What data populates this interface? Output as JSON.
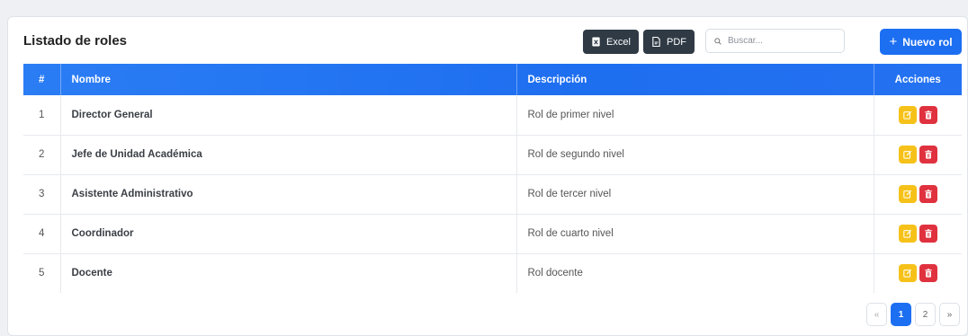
{
  "header": {
    "title": "Listado de roles",
    "excel_label": "Excel",
    "pdf_label": "PDF",
    "search_placeholder": "Buscar...",
    "new_label": "Nuevo rol"
  },
  "table": {
    "columns": [
      "#",
      "Nombre",
      "Descripción",
      "Acciones"
    ],
    "rows": [
      {
        "num": "1",
        "name": "Director General",
        "desc": "Rol de primer nivel"
      },
      {
        "num": "2",
        "name": "Jefe de Unidad Académica",
        "desc": "Rol de segundo nivel"
      },
      {
        "num": "3",
        "name": "Asistente Administrativo",
        "desc": "Rol de tercer nivel"
      },
      {
        "num": "4",
        "name": "Coordinador",
        "desc": "Rol de cuarto nivel"
      },
      {
        "num": "5",
        "name": "Docente",
        "desc": "Rol docente"
      }
    ]
  },
  "pagination": {
    "prev": "«",
    "pages": [
      "1",
      "2"
    ],
    "active_page": "1",
    "next": "»"
  },
  "icons": {
    "excel": "file-excel-icon",
    "pdf": "file-pdf-icon",
    "search": "search-icon",
    "edit": "edit-icon",
    "delete": "trash-icon"
  },
  "colors": {
    "primary": "#1d6ff2",
    "dark_button": "#2f3a45",
    "edit": "#f6c21a",
    "delete": "#e0313f"
  }
}
